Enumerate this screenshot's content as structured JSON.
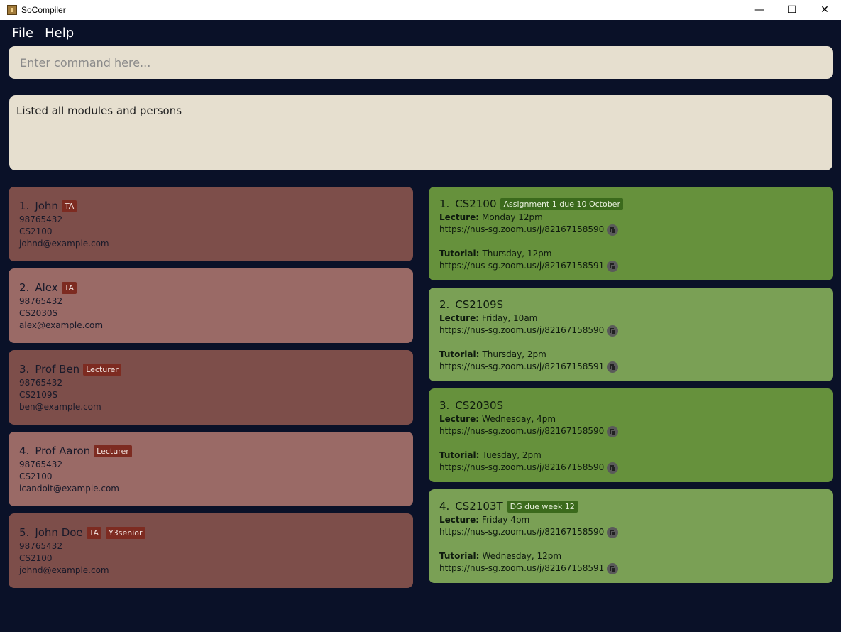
{
  "window": {
    "title": "SoCompiler",
    "minimize": "—",
    "maximize": "☐",
    "close": "✕"
  },
  "menu": {
    "file": "File",
    "help": "Help"
  },
  "command": {
    "placeholder": "Enter command here...",
    "value": ""
  },
  "result": {
    "text": "Listed all modules and persons"
  },
  "persons": [
    {
      "index": "1.",
      "name": "John",
      "tags": [
        "TA"
      ],
      "phone": "98765432",
      "module": "CS2100",
      "email": "johnd@example.com"
    },
    {
      "index": "2.",
      "name": "Alex",
      "tags": [
        "TA"
      ],
      "phone": "98765432",
      "module": "CS2030S",
      "email": "alex@example.com"
    },
    {
      "index": "3.",
      "name": "Prof Ben",
      "tags": [
        "Lecturer"
      ],
      "phone": "98765432",
      "module": "CS2109S",
      "email": "ben@example.com"
    },
    {
      "index": "4.",
      "name": "Prof Aaron",
      "tags": [
        "Lecturer"
      ],
      "phone": "98765432",
      "module": "CS2100",
      "email": "icandoit@example.com"
    },
    {
      "index": "5.",
      "name": "John Doe",
      "tags": [
        "TA",
        "Y3senior"
      ],
      "phone": "98765432",
      "module": "CS2100",
      "email": "johnd@example.com"
    }
  ],
  "labels": {
    "lecture": "Lecture:",
    "tutorial": "Tutorial:"
  },
  "modules": [
    {
      "index": "1.",
      "code": "CS2100",
      "tags": [
        "Assignment 1 due 10 October"
      ],
      "lecture_time": "Monday 12pm",
      "lecture_link": "https://nus-sg.zoom.us/j/82167158590",
      "tutorial_time": "Thursday, 12pm",
      "tutorial_link": "https://nus-sg.zoom.us/j/82167158591"
    },
    {
      "index": "2.",
      "code": "CS2109S",
      "tags": [],
      "lecture_time": "Friday, 10am",
      "lecture_link": "https://nus-sg.zoom.us/j/82167158590",
      "tutorial_time": "Thursday, 2pm",
      "tutorial_link": "https://nus-sg.zoom.us/j/82167158591"
    },
    {
      "index": "3.",
      "code": "CS2030S",
      "tags": [],
      "lecture_time": "Wednesday, 4pm",
      "lecture_link": "https://nus-sg.zoom.us/j/82167158590",
      "tutorial_time": "Tuesday, 2pm",
      "tutorial_link": "https://nus-sg.zoom.us/j/82167158590"
    },
    {
      "index": "4.",
      "code": "CS2103T",
      "tags": [
        "DG due week 12"
      ],
      "lecture_time": "Friday 4pm",
      "lecture_link": "https://nus-sg.zoom.us/j/82167158590",
      "tutorial_time": "Wednesday, 12pm",
      "tutorial_link": "https://nus-sg.zoom.us/j/82167158591"
    }
  ],
  "colors": {
    "background": "#0a1128",
    "box": "#e6dfcf",
    "person_dark": "#7d4e4a",
    "person_light": "#9a6a66",
    "module_dark": "#66913c",
    "module_light": "#7aa055",
    "tag_red": "#7d2b21",
    "tag_green": "#3b6a1c"
  },
  "icons": {
    "app": "app-icon",
    "copy": "copy-icon"
  }
}
